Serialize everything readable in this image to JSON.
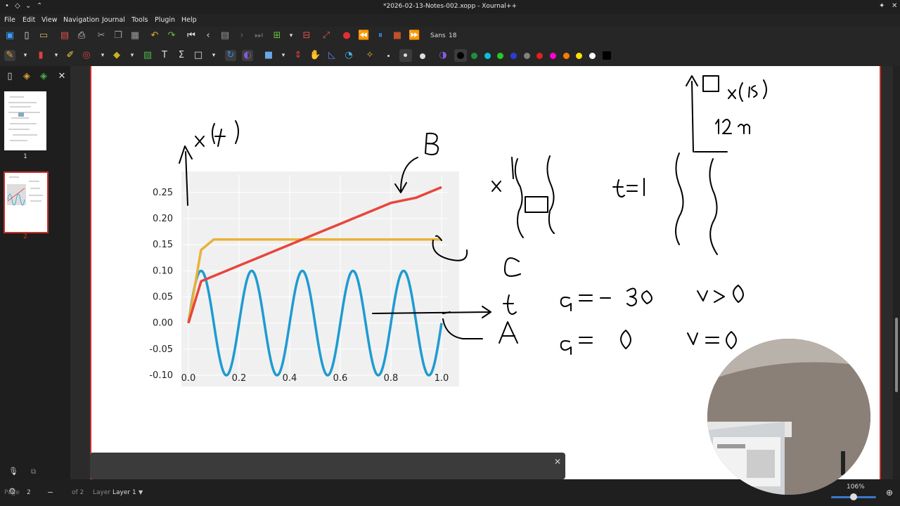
{
  "window": {
    "title": "*2026-02-13-Notes-002.xopp - Xournal++"
  },
  "menu": [
    "File",
    "Edit",
    "View",
    "Navigation",
    "Journal",
    "Tools",
    "Plugin",
    "Help"
  ],
  "toolbar": {
    "font_name": "Sans",
    "font_size": "18"
  },
  "colors": {
    "accent": "#c9302c",
    "pen_palette": [
      "#000000",
      "#1e8f3a",
      "#0bbfd8",
      "#22cc22",
      "#2f3bd6",
      "#808080",
      "#e51e1e",
      "#ff7a00",
      "#ff00d0",
      "#ffe000",
      "#ffffff"
    ]
  },
  "sidebar": {
    "pages": [
      {
        "label": "1"
      },
      {
        "label": "2"
      }
    ]
  },
  "status": {
    "page_label": "Page",
    "page_value": "2",
    "of_pages": "of 2",
    "layer_label": "Layer",
    "layer_value": "Layer 1",
    "zoom": "106%"
  },
  "chart_data": {
    "type": "line",
    "x": [
      0.0,
      0.05,
      0.1,
      0.2,
      0.3,
      0.4,
      0.5,
      0.6,
      0.7,
      0.8,
      0.9,
      1.0
    ],
    "xlim": [
      0.0,
      1.0
    ],
    "ylim": [
      -0.1,
      0.27
    ],
    "xticks": [
      "0.0",
      "0.2",
      "0.4",
      "0.6",
      "0.8",
      "1.0"
    ],
    "yticks": [
      "0.25",
      "0.20",
      "0.15",
      "0.10",
      "0.05",
      "0.00",
      "-0.05",
      "-0.10"
    ],
    "grid": true,
    "series": [
      {
        "color": "#1f9bd1",
        "shape": "sine",
        "amplitude": 0.1,
        "cycles": 5
      },
      {
        "color": "#e8b23a",
        "values": [
          0.0,
          0.14,
          0.16,
          0.16,
          0.16,
          0.16,
          0.16,
          0.16,
          0.16,
          0.16,
          0.16,
          0.16
        ]
      },
      {
        "color": "#e8453c",
        "values": [
          0.0,
          0.08,
          0.09,
          0.11,
          0.13,
          0.15,
          0.17,
          0.19,
          0.21,
          0.23,
          0.24,
          0.26
        ]
      }
    ]
  }
}
